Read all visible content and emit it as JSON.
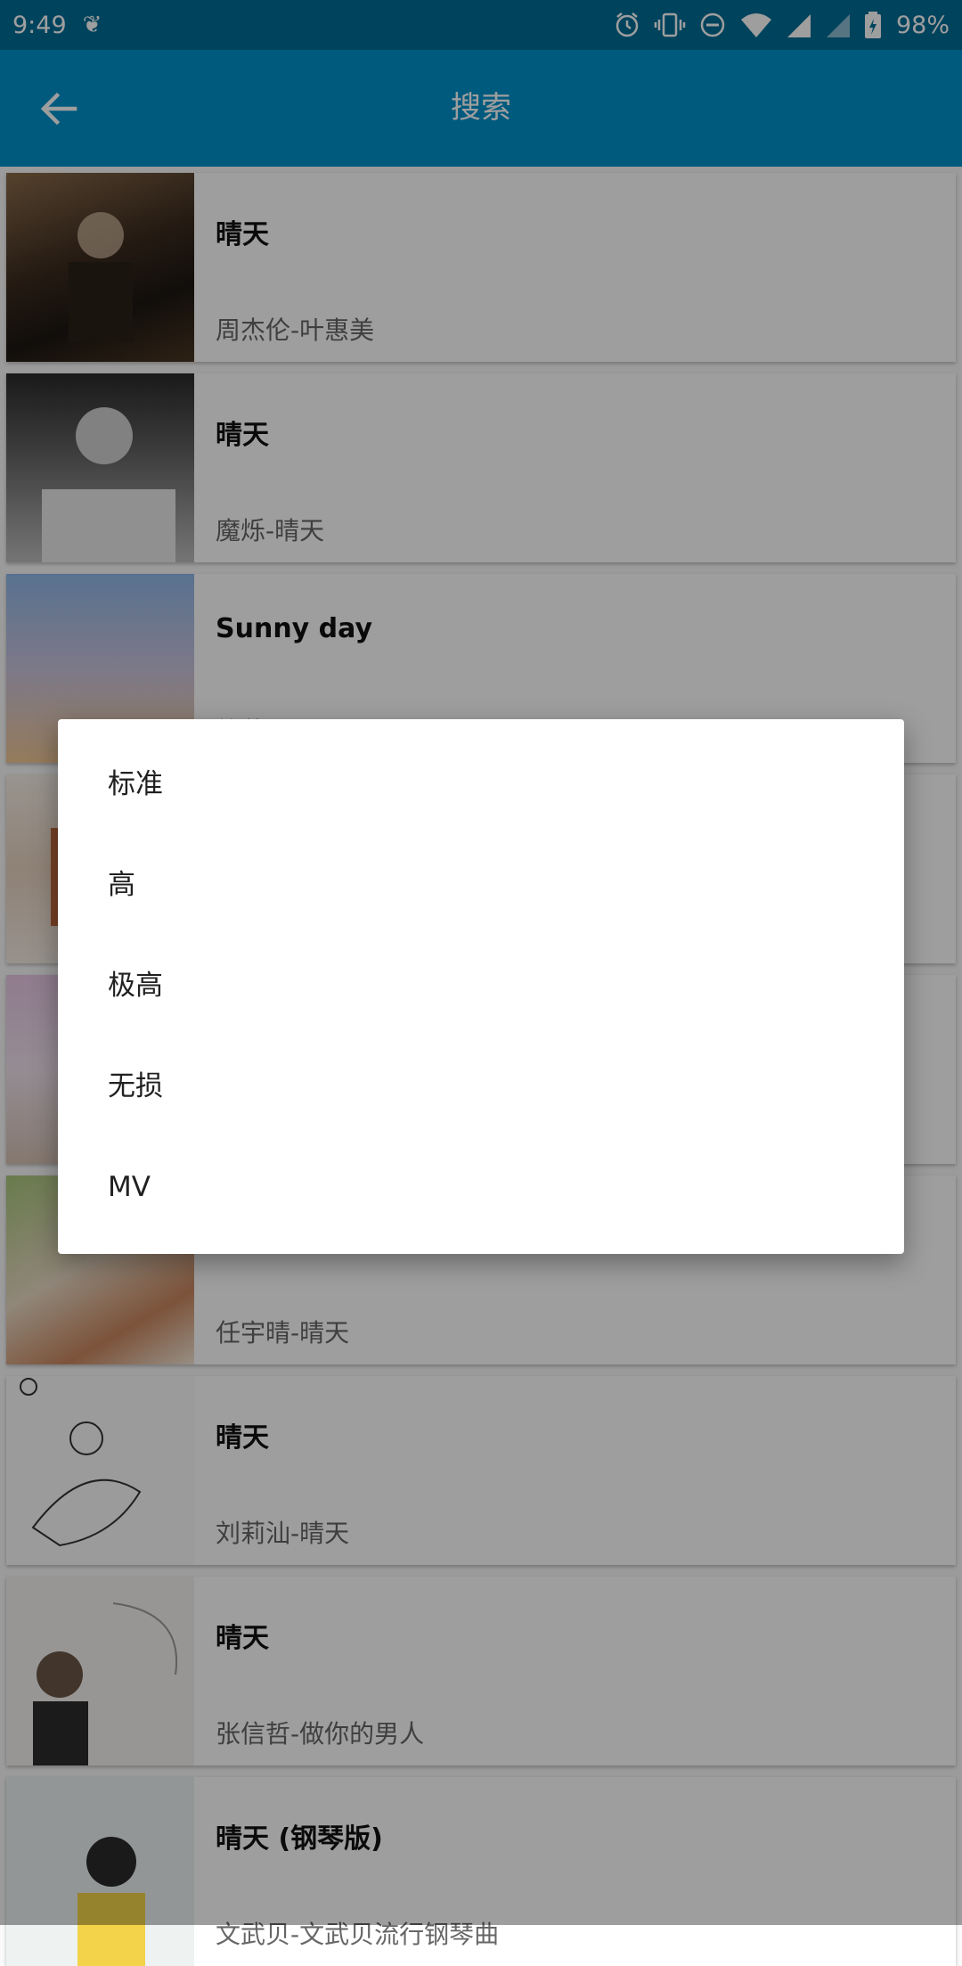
{
  "status_bar": {
    "time": "9:49",
    "battery": "98%",
    "icons": [
      "maple-leaf-icon",
      "alarm-icon",
      "vibrate-icon",
      "do-not-disturb-icon",
      "wifi-icon",
      "signal-icon",
      "signal-icon",
      "battery-icon"
    ]
  },
  "app_bar": {
    "title": "搜索",
    "back_icon": "arrow-back-icon"
  },
  "songs": [
    {
      "title": "晴天",
      "subtitle": "周杰伦-叶惠美"
    },
    {
      "title": "晴天",
      "subtitle": "魔烁-晴天"
    },
    {
      "title": "Sunny day",
      "subtitle": "徐莉园-Sunny day"
    },
    {
      "title": "",
      "subtitle": ""
    },
    {
      "title": "",
      "subtitle": ""
    },
    {
      "title": "",
      "subtitle": "任宇晴-晴天"
    },
    {
      "title": "晴天",
      "subtitle": "刘莉汕-晴天"
    },
    {
      "title": "晴天",
      "subtitle": "张信哲-做你的男人"
    },
    {
      "title": "晴天 (钢琴版)",
      "subtitle": "文武贝-文武贝流行钢琴曲"
    }
  ],
  "dialog": {
    "options": [
      "标准",
      "高",
      "极高",
      "无损",
      "MV"
    ]
  },
  "colors": {
    "status_bar": "#006c97",
    "app_bar": "#0092cb",
    "scrim": "rgba(0,0,0,0.38)"
  }
}
